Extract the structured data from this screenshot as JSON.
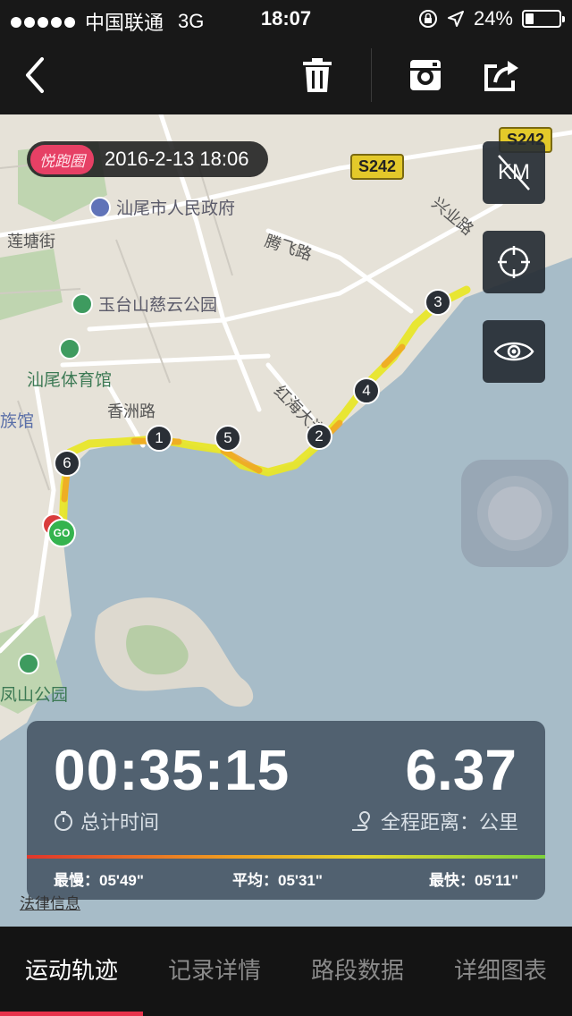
{
  "status_bar": {
    "carrier": "中国联通",
    "network": "3G",
    "time": "18:07",
    "battery": "24%",
    "battery_fraction": 0.24
  },
  "toolbar": {
    "back_icon": "chevron-left-icon",
    "delete_icon": "trash-icon",
    "instagram_icon": "camera-icon",
    "share_icon": "share-icon"
  },
  "map": {
    "badge": "悦跑圈",
    "date": "2016-2-13 18:06",
    "km_toggle_label": "KM",
    "pois": {
      "government": "汕尾市人民政府",
      "park": "玉台山慈云公园",
      "stadium": "汕尾体育馆",
      "fengshan_park": "凤山公园",
      "museum_partial": "族馆"
    },
    "roads": {
      "lianbo": "莲塘街",
      "tengfei": "腾飞路",
      "xingye": "兴业路",
      "xiangzhou": "香洲路",
      "honghai": "红海大道",
      "s242_a": "S242",
      "s242_b": "S242"
    },
    "markers": [
      "1",
      "2",
      "3",
      "4",
      "5",
      "6"
    ],
    "start_label": "GO",
    "legal": "法律信息"
  },
  "stats": {
    "total_time": "00:35:15",
    "total_time_label": "总计时间",
    "distance": "6.37",
    "distance_label": "全程距离：公里",
    "slowest": "最慢：05'49\"",
    "average": "平均：05'31\"",
    "fastest": "最快：05'11\""
  },
  "tabs": [
    "运动轨迹",
    "记录详情",
    "路段数据",
    "详细图表"
  ],
  "colors": {
    "accent": "#e6334b",
    "route": "#e8e62a",
    "stats_panel": "#4c5c6c",
    "water": "#a7bcc8"
  }
}
